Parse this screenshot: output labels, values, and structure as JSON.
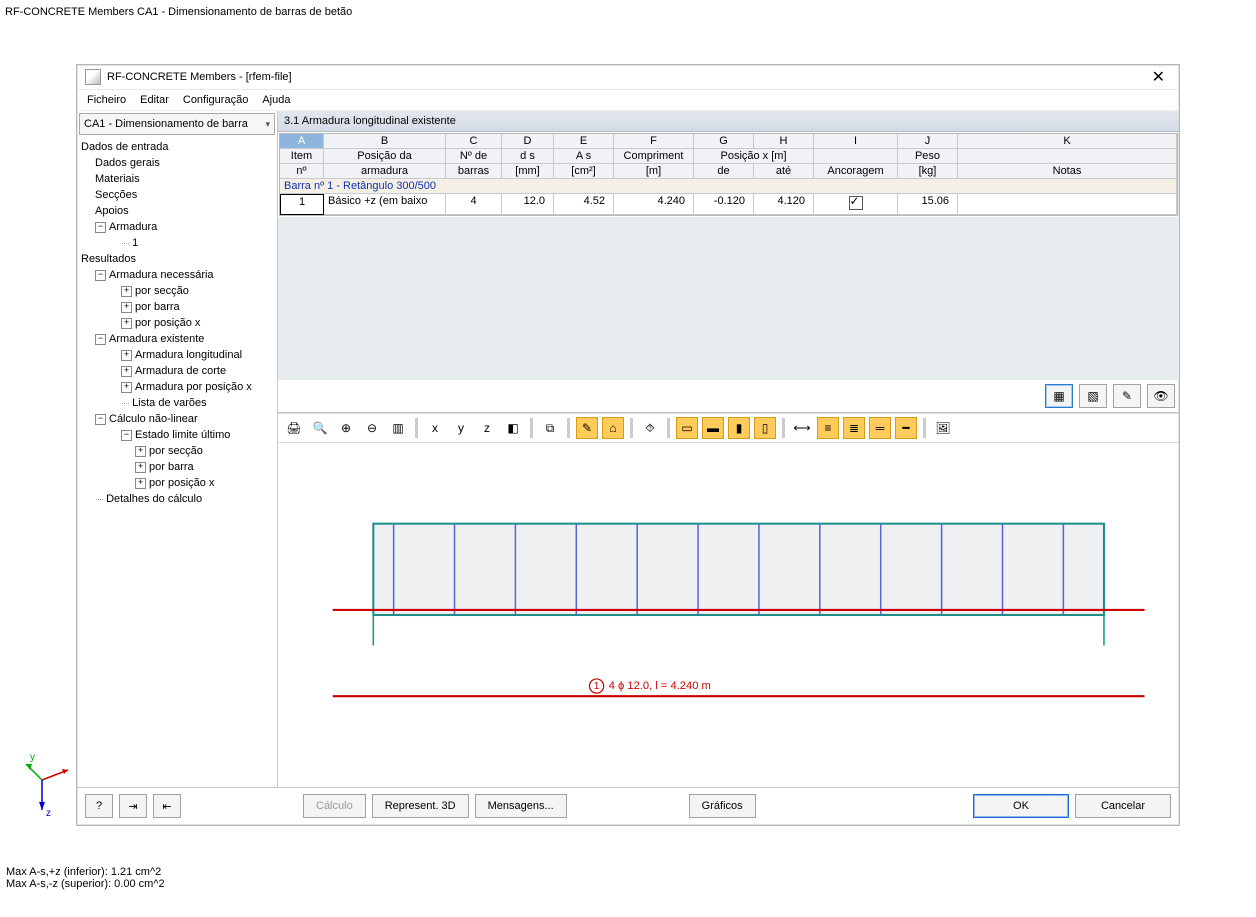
{
  "background": {
    "title": "RF-CONCRETE Members CA1 - Dimensionamento de barras de betão",
    "axes": {
      "x": "x",
      "y": "y",
      "z": "z"
    },
    "stats_line1": "Max A-s,+z (inferior): 1.21 cm^2",
    "stats_line2": "Max A-s,-z (superior): 0.00 cm^2"
  },
  "window": {
    "title": "RF-CONCRETE Members - [rfem-file]",
    "menu": [
      "Ficheiro",
      "Editar",
      "Configuração",
      "Ajuda"
    ],
    "combo": "CA1 - Dimensionamento de barra",
    "section_title": "3.1 Armadura longitudinal existente"
  },
  "tree": {
    "dados_entrada": "Dados de entrada",
    "dados_gerais": "Dados gerais",
    "materiais": "Materiais",
    "seccoes": "Secções",
    "apoios": "Apoios",
    "armadura": "Armadura",
    "arm_1": "1",
    "resultados": "Resultados",
    "arm_necessaria": "Armadura necessária",
    "por_seccao": "por secção",
    "por_barra": "por barra",
    "por_posicao_x": "por posição x",
    "arm_existente": "Armadura existente",
    "arm_long": "Armadura longitudinal",
    "arm_corte": "Armadura de corte",
    "arm_pos_x": "Armadura por posição x",
    "lista_varoes": "Lista de varões",
    "calc_nlin": "Cálculo não-linear",
    "elu": "Estado limite último",
    "detalhes": "Detalhes do cálculo"
  },
  "table": {
    "col_letters": [
      "A",
      "B",
      "C",
      "D",
      "E",
      "F",
      "G",
      "H",
      "I",
      "J",
      "K"
    ],
    "h_item": "Item",
    "h_item2": "nº",
    "h_pos": "Posição da",
    "h_pos2": "armadura",
    "h_n": "Nº de",
    "h_n2": "barras",
    "h_ds": "d s",
    "h_ds2": "[mm]",
    "h_as": "A s",
    "h_as2": "[cm²]",
    "h_comp": "Compriment",
    "h_comp2": "[m]",
    "h_posx": "Posição x [m]",
    "h_de": "de",
    "h_ate": "até",
    "h_anc": "Ancoragem",
    "h_peso": "Peso",
    "h_peso2": "[kg]",
    "h_notas": "Notas",
    "group_row": "Barra nº 1 - Retângulo 300/500",
    "row": {
      "item": "1",
      "pos": "Básico +z (em baixo",
      "n": "4",
      "ds": "12.0",
      "as": "4.52",
      "len": "4.240",
      "de": "-0.120",
      "ate": "4.120",
      "anc": true,
      "peso": "15.06",
      "notas": ""
    }
  },
  "graphic": {
    "label_num": "1",
    "label_text": "4 ϕ 12.0, l = 4.240 m"
  },
  "footer": {
    "calculo": "Cálculo",
    "repres": "Represent. 3D",
    "mensagens": "Mensagens...",
    "graficos": "Gráficos",
    "ok": "OK",
    "cancelar": "Cancelar"
  }
}
